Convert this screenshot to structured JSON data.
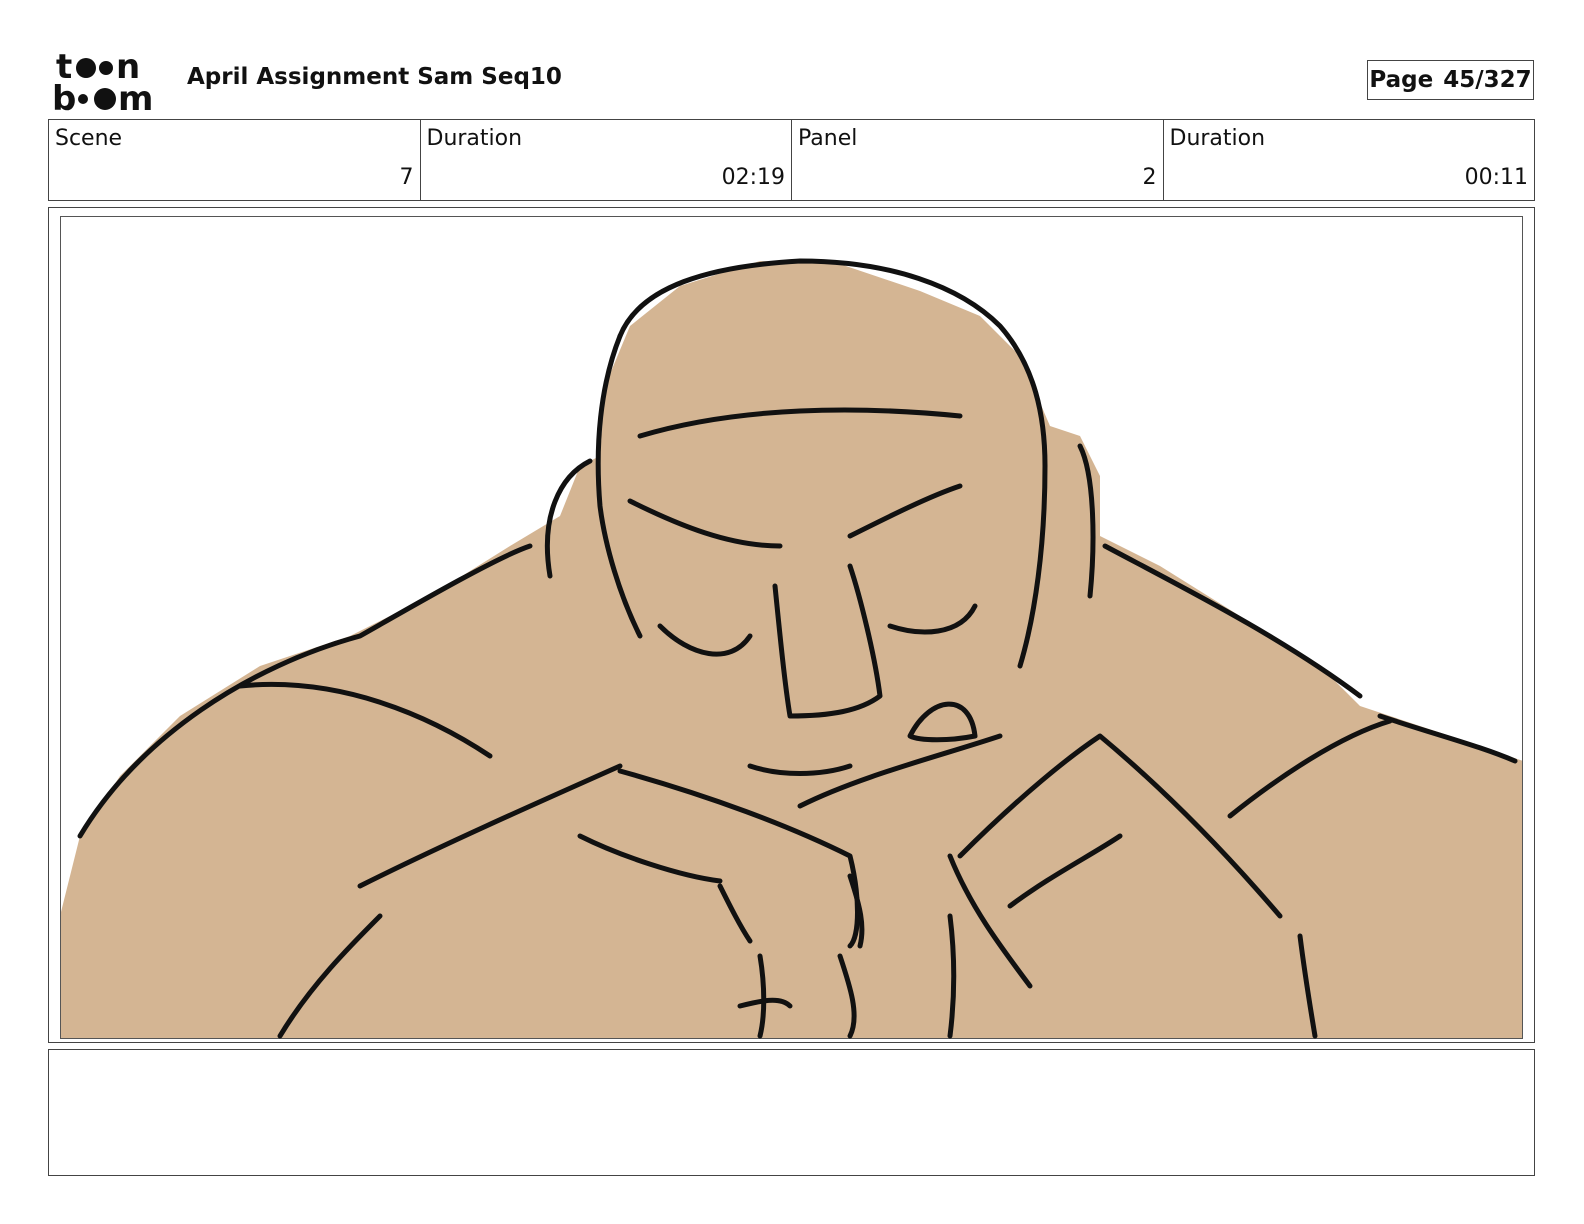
{
  "header": {
    "logo_text": "toon boom",
    "title": "April Assignment Sam Seq10",
    "page_label": "Page",
    "page_value": "45/327"
  },
  "info": [
    {
      "label": "Scene",
      "value": "7"
    },
    {
      "label": "Duration",
      "value": "02:19"
    },
    {
      "label": "Panel",
      "value": "2"
    },
    {
      "label": "Duration",
      "value": "00:11"
    }
  ],
  "panel": {
    "skin_color": "#d4b593",
    "line_color": "#111111"
  },
  "notes": {
    "text": ""
  }
}
